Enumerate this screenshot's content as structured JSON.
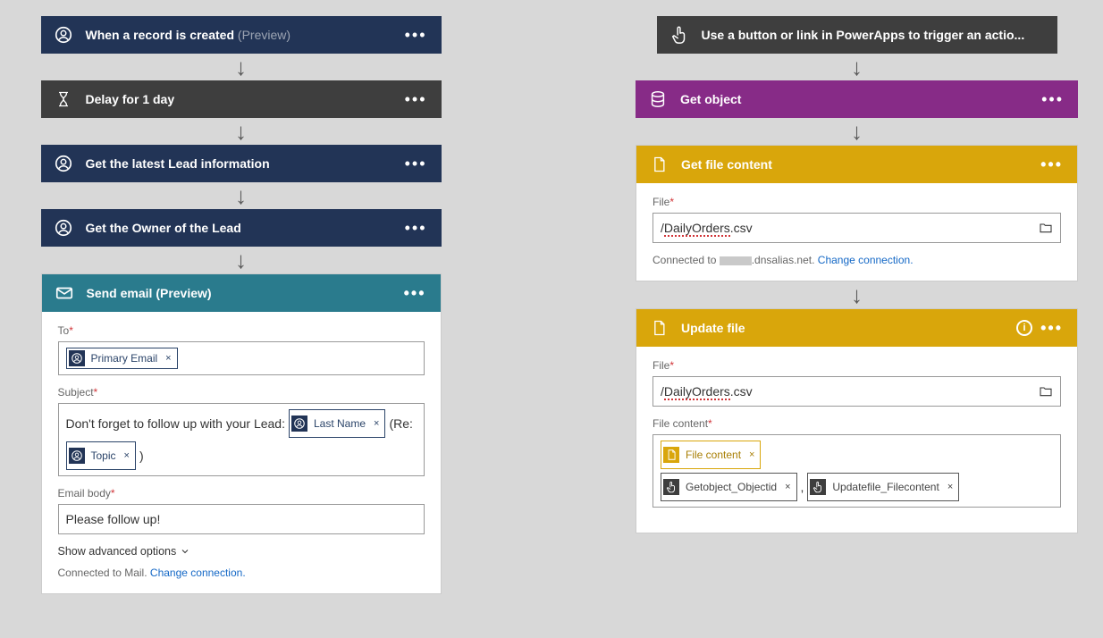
{
  "left": {
    "steps": [
      {
        "title": "When a record is created",
        "preview": "(Preview)",
        "iconName": "crm-icon",
        "color": "navy"
      },
      {
        "title_html": "Delay for <b>1</b> day",
        "iconName": "hourglass-icon",
        "color": "gray"
      },
      {
        "title": "Get the latest Lead information",
        "iconName": "crm-icon",
        "color": "navy"
      },
      {
        "title": "Get the Owner of the Lead",
        "iconName": "crm-icon",
        "color": "navy"
      }
    ],
    "sendEmail": {
      "title": "Send email",
      "preview": "(Preview)",
      "to_label": "To",
      "to_token": "Primary Email",
      "subject_label": "Subject",
      "subject_prefix": "Don't forget to follow up with your Lead:  ",
      "subject_token1": "Last Name",
      "subject_mid": "  (Re:",
      "subject_token2": "Topic",
      "subject_tail": " )",
      "body_label": "Email body",
      "body_value": "Please follow up!",
      "advanced": "Show advanced options",
      "connected": "Connected to Mail.",
      "change": "Change connection."
    }
  },
  "right": {
    "steps": [
      {
        "title": "Use a button or link in PowerApps to trigger an actio...",
        "iconName": "tap-icon",
        "color": "gray"
      },
      {
        "title": "Get object",
        "iconName": "db-icon",
        "color": "purple"
      }
    ],
    "getFile": {
      "title": "Get file content",
      "file_label": "File",
      "file_value": "/DailyOrders.csv",
      "connected_pre": "Connected to ",
      "connected_host": ".dnsalias.net.",
      "change": "Change connection."
    },
    "updateFile": {
      "title": "Update file",
      "file_label": "File",
      "file_value": "/DailyOrders.csv",
      "content_label": "File content",
      "token1": "File content",
      "token2": "Getobject_Objectid",
      "sep": " , ",
      "token3": "Updatefile_Filecontent"
    }
  }
}
